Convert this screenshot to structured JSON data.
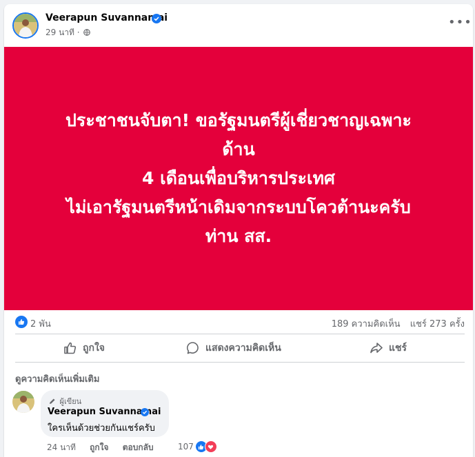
{
  "post": {
    "author": "Veerapun Suvannamai",
    "time": "29 นาที",
    "time_separator": "·",
    "more": "•••",
    "hero_lines": [
      "ประชาชนจับตา! ขอรัฐมนตรีผู้เชี่ยวชาญเฉพาะ",
      "ด้าน",
      "4 เดือนเพื่อบริหารประเทศ",
      "ไม่เอารัฐมนตรีหน้าเดิมจากระบบโควต้านะครับ",
      "ท่าน สส."
    ],
    "hero_color": "#e4003b",
    "reactions": "2 พัน",
    "comments_count": "189 ความคิดเห็น",
    "shares_count": "แชร์ 273 ครั้ง"
  },
  "actions": {
    "like": "ถูกใจ",
    "comment": "แสดงความคิดเห็น",
    "share": "แชร์"
  },
  "comments": {
    "view_more": "ดูความคิดเห็นเพิ่มเติม",
    "items": [
      {
        "author_tag": "ผู้เขียน",
        "author": "Veerapun Suvannamai",
        "text": "ใครเห็นด้วยช่วยกันแชร์ครับ",
        "time": "24 นาที",
        "like": "ถูกใจ",
        "reply": "ตอบกลับ",
        "reaction_count": "107"
      }
    ]
  },
  "colors": {
    "accent": "#1877f2",
    "love": "#f33e58",
    "secondary_text": "#65676b"
  }
}
